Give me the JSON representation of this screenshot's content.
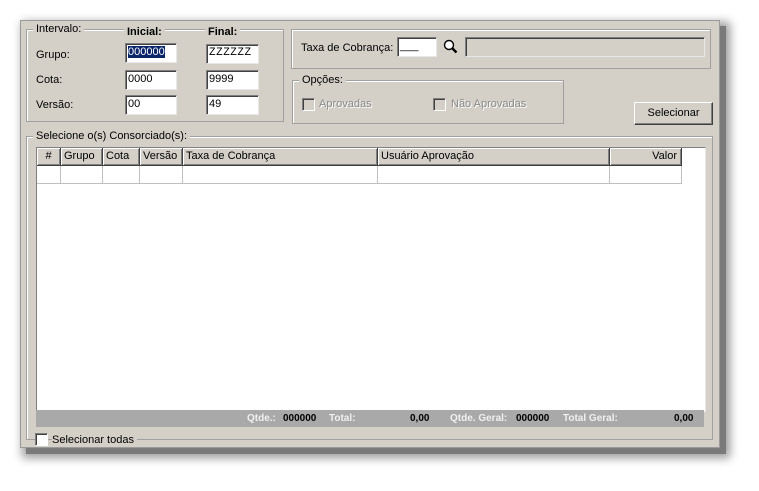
{
  "intervalo": {
    "title": "Intervalo:",
    "col_inicial": "Inicial:",
    "col_final": "Final:",
    "rows": [
      {
        "label": "Grupo:",
        "inicial": "000000",
        "final": "ZZZZZZ"
      },
      {
        "label": "Cota:",
        "inicial": "0000",
        "final": "9999"
      },
      {
        "label": "Versão:",
        "inicial": "00",
        "final": "49"
      }
    ]
  },
  "taxa": {
    "label": "Taxa de Cobrança:",
    "code_value": "___",
    "description_value": ""
  },
  "opcoes": {
    "title": "Opções:",
    "aprovadas": "Aprovadas",
    "nao_aprovadas": "Não Aprovadas"
  },
  "selecionar_button": "Selecionar",
  "consorciados": {
    "title": "Selecione o(s) Consorciado(s):",
    "columns": [
      "#",
      "Grupo",
      "Cota",
      "Versão",
      "Taxa de Cobrança",
      "Usuário Aprovação",
      "Valor"
    ]
  },
  "footer": {
    "qtde_label": "Qtde.:",
    "qtde_value": "000000",
    "total_label": "Total:",
    "total_value": "0,00",
    "qtde_geral_label": "Qtde. Geral:",
    "qtde_geral_value": "000000",
    "total_geral_label": "Total Geral:",
    "total_geral_value": "0,00"
  },
  "selecionar_todas": "Selecionar todas",
  "colors": {
    "window_bg": "#d4d0c8",
    "selection": "#0a246a",
    "footer_bg": "#a9a9a9"
  }
}
